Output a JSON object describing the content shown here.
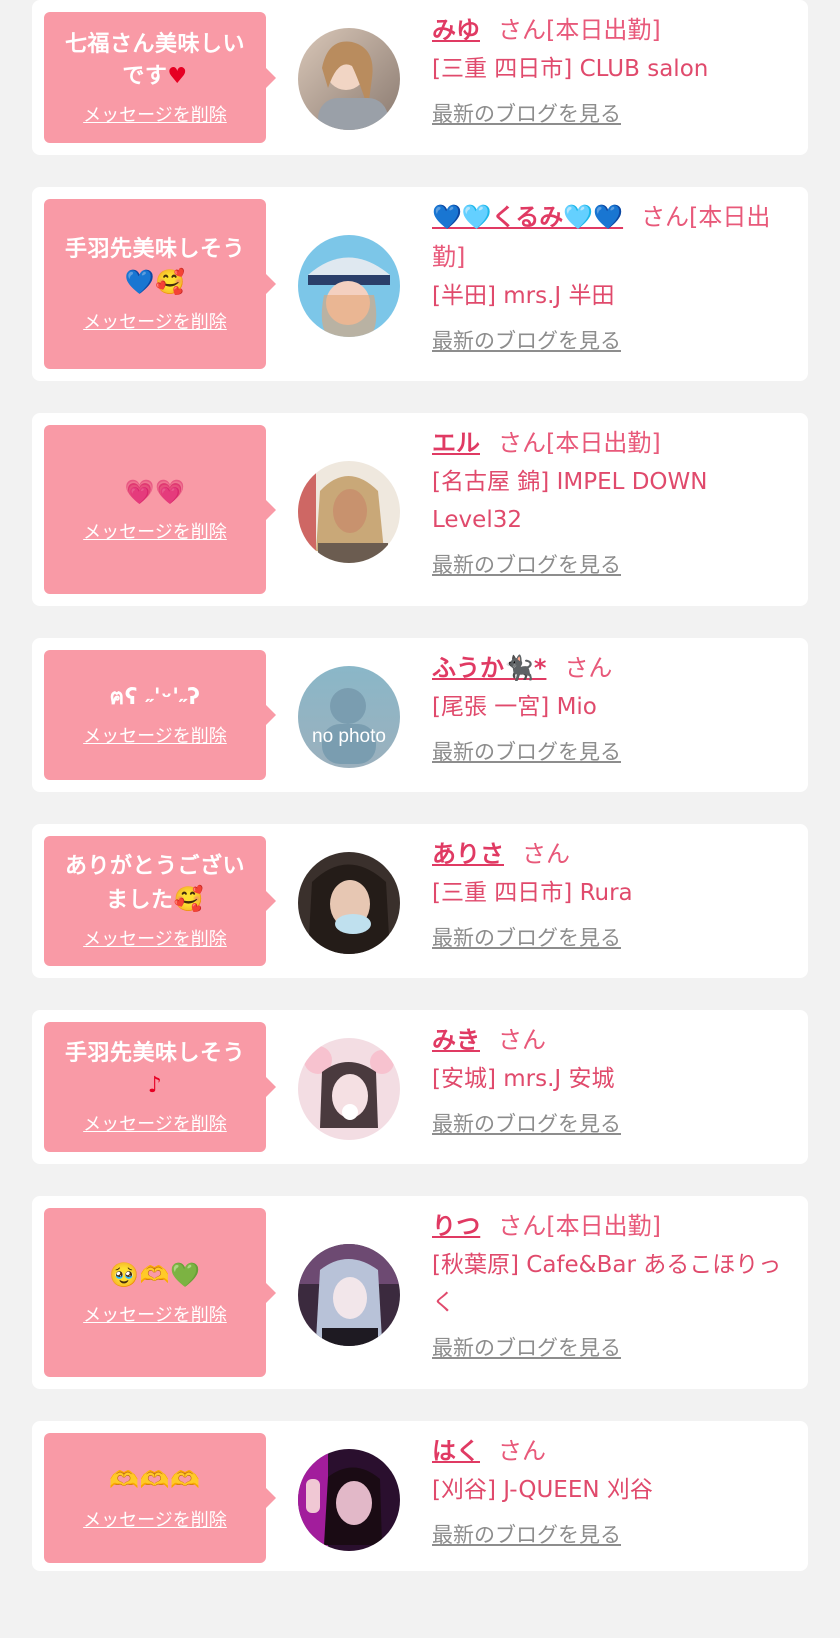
{
  "delete_label": "メッセージを削除",
  "blog_label": "最新のブログを見る",
  "accent_color": "#e03a63",
  "bubble_color": "#f99aa6",
  "cards": [
    {
      "message": "七福さん美味しい\nです",
      "message_emoji": "♥",
      "name": "みゆ",
      "honorific": "さん[本日出勤]",
      "shop": "[三重 四日市] CLUB salon",
      "avatar": "photo"
    },
    {
      "message": "手羽先美味しそう\n",
      "message_emoji": "💙🥰",
      "name": "💙🩵くるみ🩵💙",
      "honorific": "さん[本日出勤]",
      "shop": "[半田] mrs.J 半田",
      "avatar": "photo"
    },
    {
      "message": "",
      "message_emoji": "💗💗",
      "name": "エル",
      "honorific": "さん[本日出勤]",
      "shop": "[名古屋 錦] IMPEL DOWN Level32",
      "avatar": "photo"
    },
    {
      "message": "ฅʕ ˶'ᵕ'˶ʔ",
      "message_emoji": "",
      "name": "ふうか🐈‍⬛*",
      "honorific": "さん",
      "shop": "[尾張 一宮] Mio",
      "avatar": "no photo"
    },
    {
      "message": "ありがとうござい\nました",
      "message_emoji": "🥰",
      "name": "ありさ",
      "honorific": "さん",
      "shop": "[三重 四日市] Rura",
      "avatar": "photo"
    },
    {
      "message": "手羽先美味しそう\n",
      "message_emoji": "♪",
      "name": "みき",
      "honorific": "さん",
      "shop": "[安城] mrs.J 安城",
      "avatar": "photo"
    },
    {
      "message": "",
      "message_emoji": "🥹🫶💚",
      "name": "りつ",
      "honorific": "さん[本日出勤]",
      "shop": "[秋葉原] Cafe&Bar あるこほりっく",
      "avatar": "photo"
    },
    {
      "message": "",
      "message_emoji": "🫶🫶🫶",
      "name": "はく",
      "honorific": "さん",
      "shop": "[刈谷] J-QUEEN 刈谷",
      "avatar": "photo"
    }
  ]
}
